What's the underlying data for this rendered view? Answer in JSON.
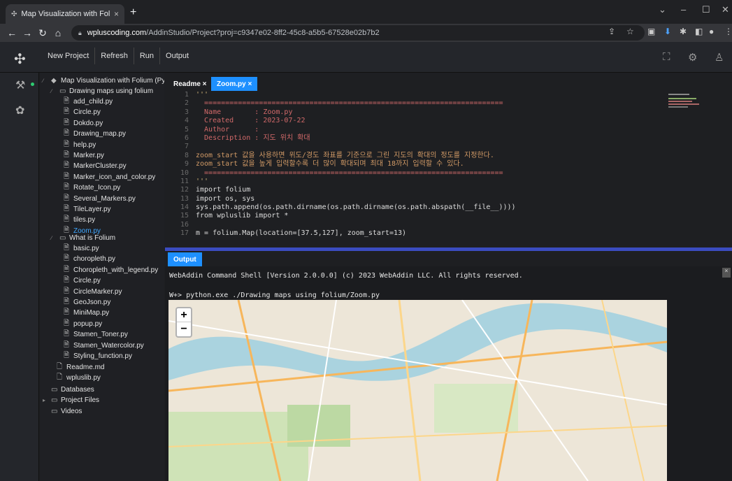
{
  "browser": {
    "tab_title": "Map Visualization with Folium (P",
    "url_host": "wpluscoding.com",
    "url_path": "/AddinStudio/Project?proj=c9347e02-8ff2-45c8-a5b5-67528e02b7b2"
  },
  "header": {
    "menu": [
      "New Project",
      "Refresh",
      "Run",
      "Output"
    ]
  },
  "tree": {
    "root": "Map Visualization with Folium (Pyt",
    "folder1": "Drawing maps using folium",
    "folder1_files": [
      "add_child.py",
      "Circle.py",
      "Dokdo.py",
      "Drawing_map.py",
      "help.py",
      "Marker.py",
      "MarkerCluster.py",
      "Marker_icon_and_color.py",
      "Rotate_Icon.py",
      "Several_Markers.py",
      "TileLayer.py",
      "tiles.py",
      "Zoom.py"
    ],
    "folder2": "What is Folium",
    "folder2_files": [
      "basic.py",
      "choropleth.py",
      "Choropleth_with_legend.py",
      "Circle.py",
      "CircleMarker.py",
      "GeoJson.py",
      "MiniMap.py",
      "popup.py",
      "Stamen_Toner.py",
      "Stamen_Watercolor.py",
      "Styling_function.py"
    ],
    "root_files": [
      "Readme.md",
      "wpluslib.py"
    ],
    "top_folders": [
      "Databases",
      "Project Files",
      "Videos"
    ]
  },
  "editor": {
    "tabs": [
      "Readme ×",
      "Zoom.py ×"
    ],
    "line_numbers": [
      "1",
      "2",
      "3",
      "4",
      "5",
      "6",
      "7",
      "8",
      "9",
      "10",
      "11",
      "12",
      "13",
      "14",
      "15",
      "16",
      "17"
    ],
    "lines": [
      "'''",
      "  =======================================================================",
      "  Name        : Zoom.py",
      "  Created     : 2023-07-22",
      "  Author      :",
      "  Description : 지도 위치 확대",
      "",
      "zoom_start 값을 사용하면 위도/경도 좌표를 기준으로 그린 지도의 확대의 정도를 지정한다.",
      "zoom_start 값을 높게 입력할수록 더 많이 확대되며 최대 18까지 입력할 수 있다.",
      "  =======================================================================",
      "'''",
      "import folium",
      "import os, sys",
      "sys.path.append(os.path.dirname(os.path.dirname(os.path.abspath(__file__))))",
      "from wpluslib import *",
      "",
      "m = folium.Map(location=[37.5,127], zoom_start=13)"
    ]
  },
  "output": {
    "tab": "Output",
    "banner": "WebAddin Command Shell [Version 2.0.0.0] (c) 2023 WebAddin LLC. All rights reserved.",
    "command": "W+> python.exe ./Drawing maps using folium/Zoom.py"
  },
  "map": {
    "zoom_in": "+",
    "zoom_out": "−"
  }
}
